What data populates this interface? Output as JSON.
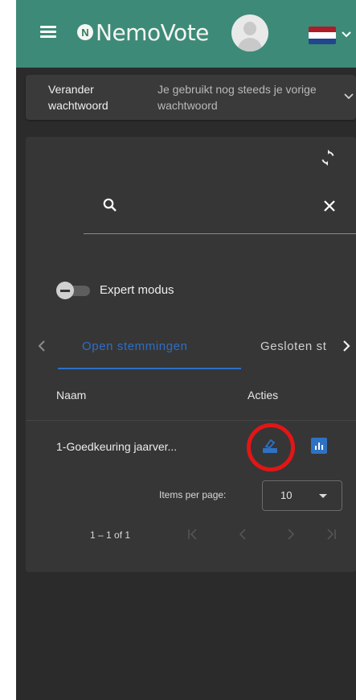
{
  "header": {
    "logo_mark": "N",
    "logo_text": "NemoVote",
    "menu_icon": "menu-icon",
    "avatar_icon": "user-avatar-icon",
    "language_flag": "netherlands-flag",
    "brand_color": "#3d8a78"
  },
  "notice": {
    "title": "Verander wachtwoord",
    "description": "Je gebruikt nog steeds je vorige wachtwoord"
  },
  "toolbar": {
    "refresh_icon": "refresh-icon"
  },
  "search": {
    "value": "",
    "placeholder": ""
  },
  "expert_mode": {
    "label": "Expert modus",
    "enabled": false
  },
  "tabs": [
    {
      "label": "Open stemmingen",
      "active": true
    },
    {
      "label": "Gesloten st",
      "active": false
    }
  ],
  "table": {
    "columns": [
      "Naam",
      "Acties"
    ],
    "rows": [
      {
        "name": "1-Goedkeuring jaarver...",
        "actions": [
          "vote-icon",
          "results-icon"
        ]
      }
    ]
  },
  "highlight": {
    "color": "#e11616",
    "target": "vote-icon"
  },
  "pagination": {
    "items_per_page_label": "Items per page:",
    "items_per_page": "10",
    "range_label": "1 – 1 of 1"
  },
  "accent_color": "#2e6fc8"
}
